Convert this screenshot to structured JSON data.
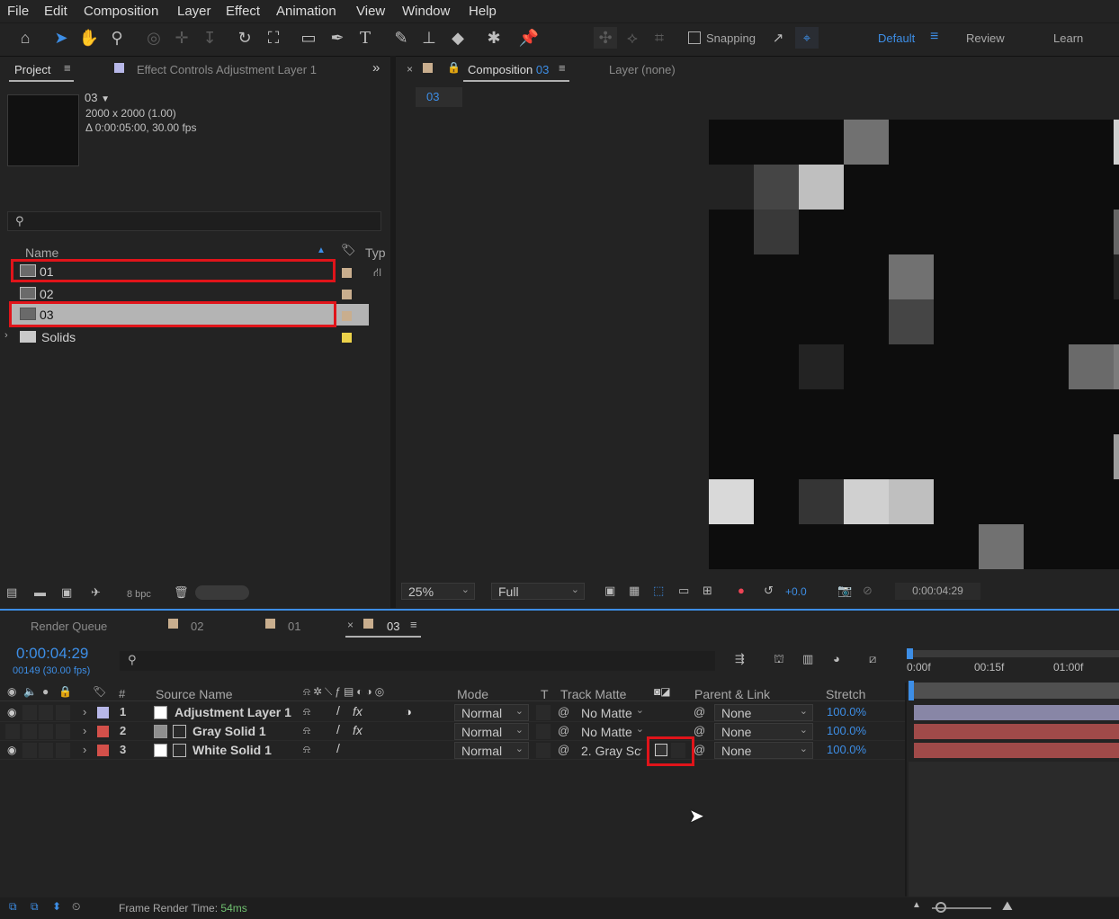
{
  "menu": [
    "File",
    "Edit",
    "Composition",
    "Layer",
    "Effect",
    "Animation",
    "View",
    "Window",
    "Help"
  ],
  "toolbar": {
    "snapping": "Snapping",
    "workspaces": [
      "Default",
      "Review",
      "Learn"
    ]
  },
  "project": {
    "tab": "Project",
    "effect_controls": "Effect Controls",
    "effect_controls_layer": "Adjustment Layer 1",
    "comp_name": "03",
    "comp_size": "2000 x 2000 (1.00)",
    "comp_dur": "Δ 0:00:05:00, 30.00 fps",
    "col_name": "Name",
    "col_type": "Typ",
    "items": [
      "01",
      "02",
      "03",
      "Solids"
    ],
    "bpc": "8 bpc"
  },
  "comp": {
    "tab_prefix": "Composition",
    "tab_name": "03",
    "layer_tab": "Layer (none)",
    "flow": "03",
    "zoom": "25%",
    "res": "Full",
    "exposure": "+0.0",
    "timecode": "0:00:04:29"
  },
  "grid": [
    [
      0,
      0,
      0,
      0.45,
      0,
      0,
      0,
      0,
      0,
      0.88
    ],
    [
      0.1,
      0.25,
      0.8,
      0,
      0,
      0,
      0,
      0,
      0,
      0
    ],
    [
      0,
      0.2,
      0,
      0,
      0,
      0,
      0,
      0,
      0,
      0.4
    ],
    [
      0,
      0,
      0,
      0,
      0.45,
      0,
      0,
      0,
      0,
      0.1
    ],
    [
      0,
      0,
      0,
      0,
      0.25,
      0,
      0,
      0,
      0,
      0
    ],
    [
      0,
      0,
      0.1,
      0,
      0,
      0,
      0,
      0,
      0.42,
      0.5
    ],
    [
      0,
      0,
      0,
      0,
      0,
      0,
      0,
      0,
      0,
      0
    ],
    [
      0,
      0,
      0,
      0,
      0,
      0,
      0,
      0,
      0,
      0.65
    ],
    [
      0.92,
      0,
      0.18,
      0.88,
      0.8,
      0,
      0,
      0,
      0,
      0
    ],
    [
      0,
      0,
      0,
      0,
      0,
      0,
      0.45,
      0,
      0,
      0
    ]
  ],
  "timeline": {
    "tabs": [
      "Render Queue",
      "02",
      "01",
      "03"
    ],
    "time": "0:00:04:29",
    "frames": "00149 (30.00 fps)",
    "cols": {
      "num": "#",
      "source": "Source Name",
      "mode": "Mode",
      "t": "T",
      "track": "Track Matte",
      "parent": "Parent & Link",
      "stretch": "Stretch"
    },
    "layers": [
      {
        "num": "1",
        "name": "Adjustment Layer 1",
        "mode": "Normal",
        "matte": "No Matte",
        "parent": "None",
        "stretch": "100.0%",
        "color": "#b7b7e8",
        "swatch": "#ffffff"
      },
      {
        "num": "2",
        "name": "Gray Solid 1",
        "mode": "Normal",
        "matte": "No Matte",
        "parent": "None",
        "stretch": "100.0%",
        "color": "#d3504a",
        "swatch": "#8f8f8f"
      },
      {
        "num": "3",
        "name": "White Solid 1",
        "mode": "Normal",
        "matte": "2. Gray Sc",
        "parent": "None",
        "stretch": "100.0%",
        "color": "#d3504a",
        "swatch": "#ffffff"
      }
    ],
    "ruler": [
      "0:00f",
      "00:15f",
      "01:00f"
    ],
    "render_time_label": "Frame Render Time:",
    "render_time": "54ms"
  },
  "colors": {
    "accent": "#3d8ee6",
    "highlight": "#e0141a",
    "layer_bar_1": "#8886a6",
    "layer_bar_2": "#a04a49"
  }
}
